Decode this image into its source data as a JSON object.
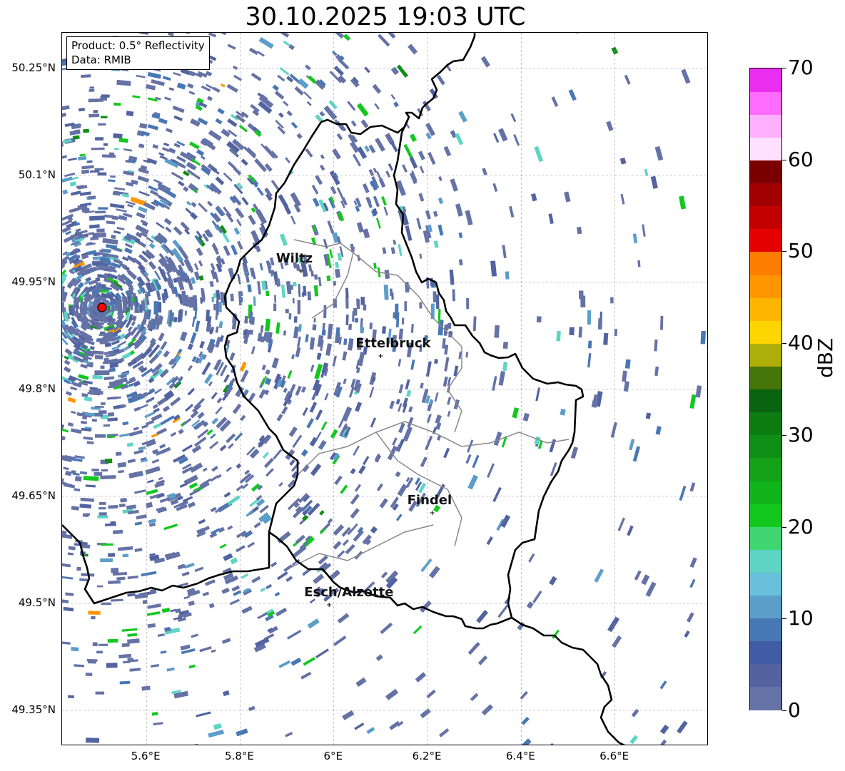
{
  "title": "30.10.2025 19:03 UTC",
  "info": {
    "product": "Product: 0.5° Reflectivity",
    "source": "Data: RMIB"
  },
  "axes": {
    "lat_ticks": [
      "50.25°N",
      "50.1°N",
      "49.95°N",
      "49.8°N",
      "49.65°N",
      "49.5°N",
      "49.35°N"
    ],
    "lon_ticks": [
      "5.6°E",
      "5.8°E",
      "6°E",
      "6.2°E",
      "6.4°E",
      "6.6°E"
    ],
    "lat_range": [
      49.3,
      50.3
    ],
    "lon_range": [
      5.42,
      6.8
    ]
  },
  "cities": [
    {
      "name": "Wiltz",
      "lon": 5.93,
      "lat": 49.966
    },
    {
      "name": "Ettelbruck",
      "lon": 6.1,
      "lat": 49.847
    },
    {
      "name": "Findel",
      "lon": 6.21,
      "lat": 49.627
    },
    {
      "name": "Esch/Alzette",
      "lon": 5.99,
      "lat": 49.498
    }
  ],
  "radar_site": {
    "lon": 5.505,
    "lat": 49.915,
    "color": "#ff0000"
  },
  "colorbar": {
    "label": "dBZ",
    "ticks": [
      "0",
      "10",
      "20",
      "30",
      "40",
      "50",
      "60",
      "70"
    ],
    "min": 0,
    "max": 70,
    "step": 2.5,
    "colors": [
      "#6572a6",
      "#5263a0",
      "#3f5ca4",
      "#4878b4",
      "#5b9ec9",
      "#69c0da",
      "#5fd4c4",
      "#3fd672",
      "#13c71f",
      "#11b41b",
      "#13a118",
      "#0f8e15",
      "#0c7b12",
      "#0a6310",
      "#46760a",
      "#adae07",
      "#fdd500",
      "#fdb500",
      "#fd9600",
      "#fd7d00",
      "#e50000",
      "#c20000",
      "#a10000",
      "#7a0000",
      "#ffe0ff",
      "#ffb1ff",
      "#ff6cff",
      "#ea2ef0"
    ]
  }
}
